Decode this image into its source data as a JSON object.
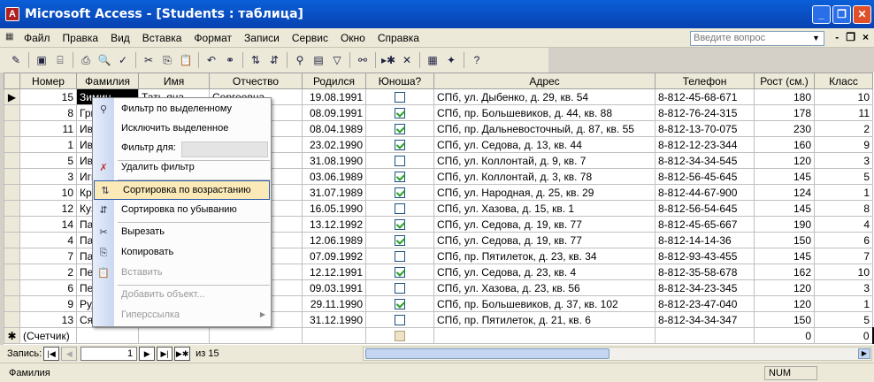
{
  "window": {
    "title": "Microsoft Access - [Students : таблица]",
    "minimize": "_",
    "restore": "❐",
    "close": "✕"
  },
  "menu": {
    "items": [
      "Файл",
      "Правка",
      "Вид",
      "Вставка",
      "Формат",
      "Записи",
      "Сервис",
      "Окно",
      "Справка"
    ],
    "help_placeholder": "Введите вопрос",
    "mdi_min": "-",
    "mdi_restore": "❐",
    "mdi_close": "×"
  },
  "toolbar": {
    "icons": [
      "design-view-icon",
      "save-icon",
      "print-preview-icon",
      "print-icon",
      "spelling-icon",
      "cut-icon",
      "copy-icon",
      "paste-icon",
      "undo-icon",
      "hyperlink-icon",
      "sort-asc-icon",
      "sort-desc-icon",
      "filter-selection-icon",
      "filter-form-icon",
      "apply-filter-icon",
      "find-icon",
      "new-record-icon",
      "delete-record-icon",
      "database-window-icon",
      "new-object-icon",
      "help-icon"
    ]
  },
  "table": {
    "columns": [
      "Номер",
      "Фамилия",
      "Имя",
      "Отчество",
      "Родился",
      "Юноша?",
      "Адрес",
      "Телефон",
      "Рост (см.)",
      "Класс"
    ],
    "rows": [
      {
        "num": "15",
        "last": "Зимин",
        "first": "Тать яна",
        "mid": "Сергеевна",
        "born": "19.08.1991",
        "boy": false,
        "addr": "СПб, ул. Дыбенко, д. 29, кв. 54",
        "phone": "8-812-45-68-671",
        "h": "180",
        "cls": "10"
      },
      {
        "num": "8",
        "last": "Гри",
        "first": "",
        "mid": "вич",
        "born": "08.09.1991",
        "boy": true,
        "addr": "СПб, пр. Большевиков, д. 44, кв. 88",
        "phone": "8-812-76-24-315",
        "h": "178",
        "cls": "11"
      },
      {
        "num": "11",
        "last": "Ива",
        "first": "",
        "mid": "вич",
        "born": "08.04.1989",
        "boy": true,
        "addr": "СПб, пр. Дальневосточный, д. 87, кв. 55",
        "phone": "8-812-13-70-075",
        "h": "230",
        "cls": "2"
      },
      {
        "num": "1",
        "last": "Ива",
        "first": "",
        "mid": "",
        "born": "23.02.1990",
        "boy": true,
        "addr": "СПб, ул. Седова, д. 13, кв. 44",
        "phone": "8-812-12-23-344",
        "h": "160",
        "cls": "9"
      },
      {
        "num": "5",
        "last": "Ива",
        "first": "",
        "mid": "",
        "born": "31.08.1990",
        "boy": false,
        "addr": "СПб, ул. Коллонтай, д. 9, кв. 7",
        "phone": "8-812-34-34-545",
        "h": "120",
        "cls": "3"
      },
      {
        "num": "3",
        "last": "Игн",
        "first": "",
        "mid": "",
        "born": "03.06.1989",
        "boy": true,
        "addr": "СПб, ул. Коллонтай, д. 3, кв. 78",
        "phone": "8-812-56-45-645",
        "h": "145",
        "cls": "5"
      },
      {
        "num": "10",
        "last": "Кра",
        "first": "",
        "mid": "",
        "born": "31.07.1989",
        "boy": true,
        "addr": "СПб, ул. Народная, д. 25, кв. 29",
        "phone": "8-812-44-67-900",
        "h": "124",
        "cls": "1"
      },
      {
        "num": "12",
        "last": "Куз",
        "first": "",
        "mid": "овна",
        "born": "16.05.1990",
        "boy": false,
        "addr": "СПб, ул. Хазова, д. 15, кв. 1",
        "phone": "8-812-56-54-645",
        "h": "145",
        "cls": "8"
      },
      {
        "num": "14",
        "last": "Па",
        "first": "",
        "mid": "вич",
        "born": "13.12.1992",
        "boy": true,
        "addr": "СПб, ул. Седова, д. 19, кв. 77",
        "phone": "8-812-45-65-667",
        "h": "190",
        "cls": "4"
      },
      {
        "num": "4",
        "last": "Па",
        "first": "",
        "mid": "вич",
        "born": "12.06.1989",
        "boy": true,
        "addr": "СПб, ул. Седова, д. 19, кв. 77",
        "phone": "8-812-14-14-36",
        "h": "150",
        "cls": "6"
      },
      {
        "num": "7",
        "last": "Па",
        "first": "",
        "mid": "овна",
        "born": "07.09.1992",
        "boy": false,
        "addr": "СПб, пр. Пятилеток, д. 23, кв. 34",
        "phone": "8-812-93-43-455",
        "h": "145",
        "cls": "7"
      },
      {
        "num": "2",
        "last": "Пет",
        "first": "",
        "mid": "",
        "born": "12.12.1991",
        "boy": true,
        "addr": "СПб, ул. Седова, д. 23, кв. 4",
        "phone": "8-812-35-58-678",
        "h": "162",
        "cls": "10"
      },
      {
        "num": "6",
        "last": "Пет",
        "first": "",
        "mid": "",
        "born": "09.03.1991",
        "boy": false,
        "addr": "СПб, ул. Хазова, д. 23, кв. 56",
        "phone": "8-812-34-23-345",
        "h": "120",
        "cls": "3"
      },
      {
        "num": "9",
        "last": "Руд",
        "first": "",
        "mid": "ч",
        "born": "29.11.1990",
        "boy": true,
        "addr": "СПб, пр. Большевиков, д. 37, кв. 102",
        "phone": "8-812-23-47-040",
        "h": "120",
        "cls": "1"
      },
      {
        "num": "13",
        "last": "Ся",
        "first": "",
        "mid": "",
        "born": "31.12.1990",
        "boy": false,
        "addr": "СПб, пр. Пятилеток, д. 21, кв. 6",
        "phone": "8-812-34-34-347",
        "h": "150",
        "cls": "5"
      }
    ],
    "new_row_marker": "✱",
    "new_row_label": "(Счетчик)",
    "new_row_h": "0",
    "new_row_cls": "0",
    "current_marker": "▶"
  },
  "context_menu": {
    "filter_selection": "Фильтр по выделенному",
    "exclude_selection": "Исключить выделенное",
    "filter_for": "Фильтр для:",
    "remove_filter": "Удалить фильтр",
    "sort_asc": "Сортировка по возрастанию",
    "sort_desc": "Сортировка по убыванию",
    "cut": "Вырезать",
    "copy": "Копировать",
    "paste": "Вставить",
    "add_object": "Добавить объект...",
    "hyperlink": "Гиперссылка"
  },
  "navigation": {
    "label": "Запись:",
    "current": "1",
    "of_label": "из 15"
  },
  "status": {
    "text": "Фамилия",
    "num": "NUM"
  }
}
